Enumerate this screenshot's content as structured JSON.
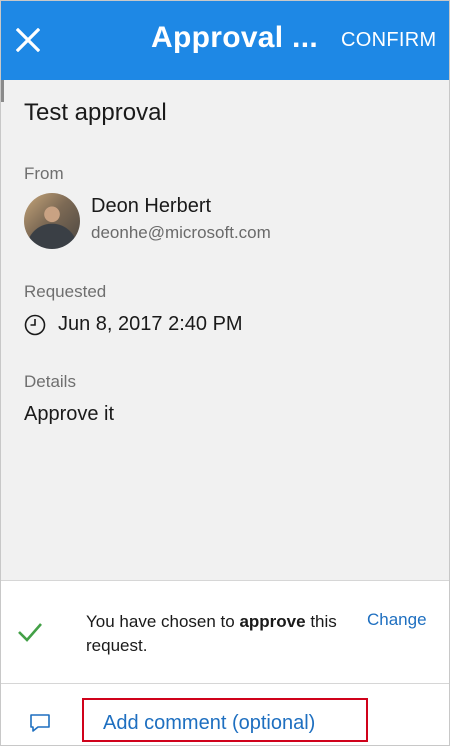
{
  "appbar": {
    "title": "Approval ...",
    "confirm_label": "CONFIRM",
    "background": "#1e88e5"
  },
  "approval": {
    "title": "Test approval",
    "from_label": "From",
    "requester_name": "Deon Herbert",
    "requester_email": "deonhe@microsoft.com",
    "requested_label": "Requested",
    "requested_value": "Jun 8, 2017 2:40 PM",
    "details_label": "Details",
    "details_value": "Approve it"
  },
  "decision": {
    "text_before": "You have chosen to ",
    "text_emphasis": "approve",
    "text_after": " this request.",
    "change_label": "Change",
    "check_color": "#43a047"
  },
  "comment": {
    "label": "Add comment (optional)",
    "link_color": "#1e6fc0",
    "highlight_color": "#d0021b"
  },
  "icons": {
    "close": "close-icon",
    "clock": "clock-icon",
    "check": "checkmark-icon",
    "comment": "comment-icon"
  }
}
